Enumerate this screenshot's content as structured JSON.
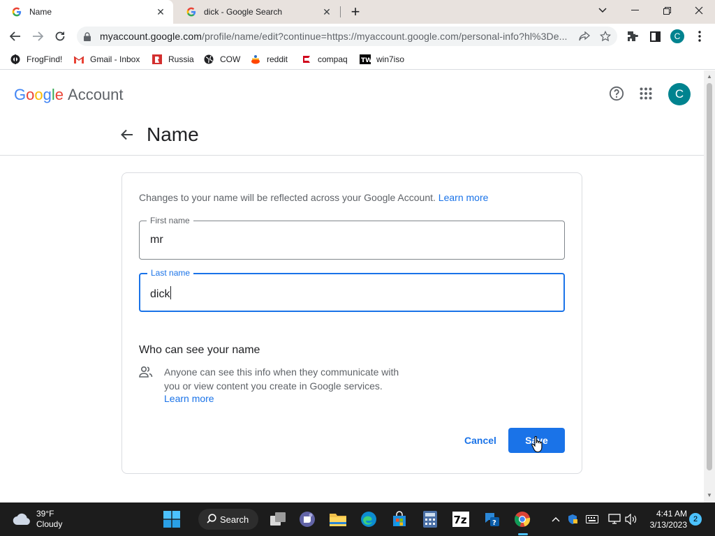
{
  "browser": {
    "tabs": [
      {
        "title": "Name",
        "active": true
      },
      {
        "title": "dick - Google Search",
        "active": false
      }
    ],
    "url_host": "myaccount.google.com",
    "url_rest": "/profile/name/edit?continue=https://myaccount.google.com/personal-info?hl%3De...",
    "profile_initial": "C",
    "bookmarks": [
      "FrogFind!",
      "Gmail - Inbox",
      "Russia",
      "COW",
      "reddit",
      "compaq",
      "win7iso"
    ]
  },
  "header": {
    "logo_google": "Google",
    "logo_account": "Account",
    "avatar_initial": "C"
  },
  "page": {
    "title": "Name",
    "intro": "Changes to your name will be reflected across your Google Account.",
    "intro_link": "Learn more",
    "first_name_label": "First name",
    "first_name_value": "mr",
    "last_name_label": "Last name",
    "last_name_value": "dick",
    "who_title": "Who can see your name",
    "who_text": "Anyone can see this info when they communicate with you or view content you create in Google services.",
    "who_link": "Learn more",
    "cancel_label": "Cancel",
    "save_label": "Save"
  },
  "taskbar": {
    "temperature": "39°F",
    "condition": "Cloudy",
    "search_label": "Search",
    "time": "4:41 AM",
    "date": "3/13/2023",
    "notification_count": "2"
  },
  "colors": {
    "accent": "#1a73e8",
    "avatar": "#00838f",
    "taskbar": "#1c1c1c"
  }
}
